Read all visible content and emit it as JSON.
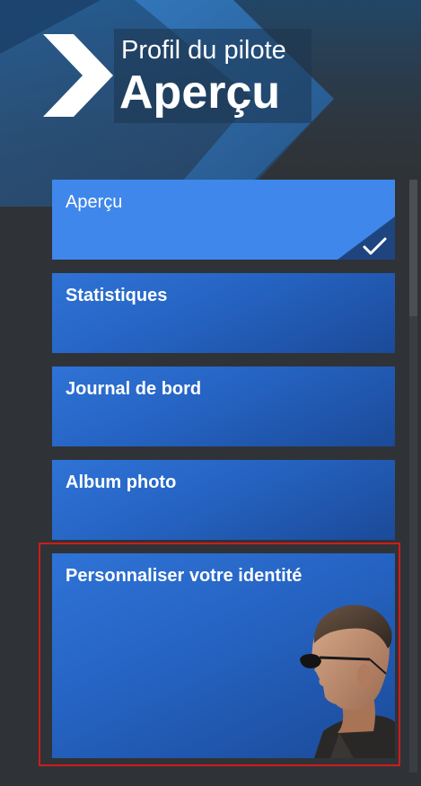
{
  "header": {
    "subtitle": "Profil du pilote",
    "title": "Aperçu"
  },
  "menu": {
    "items": [
      {
        "label": "Aperçu",
        "selected": true
      },
      {
        "label": "Statistiques",
        "selected": false
      },
      {
        "label": "Journal de bord",
        "selected": false
      },
      {
        "label": "Album photo",
        "selected": false
      },
      {
        "label": "Personnaliser votre identité",
        "selected": false,
        "focused": true
      }
    ]
  },
  "colors": {
    "background": "#2f3337",
    "accent": "#3f87ea",
    "tile": "#2563c2",
    "focus_outline": "#d11b1b"
  },
  "icons": {
    "header": "chevron-right-icon",
    "selected_marker": "checkmark-icon",
    "identity_tile_image": "pilot-portrait-avatar"
  }
}
